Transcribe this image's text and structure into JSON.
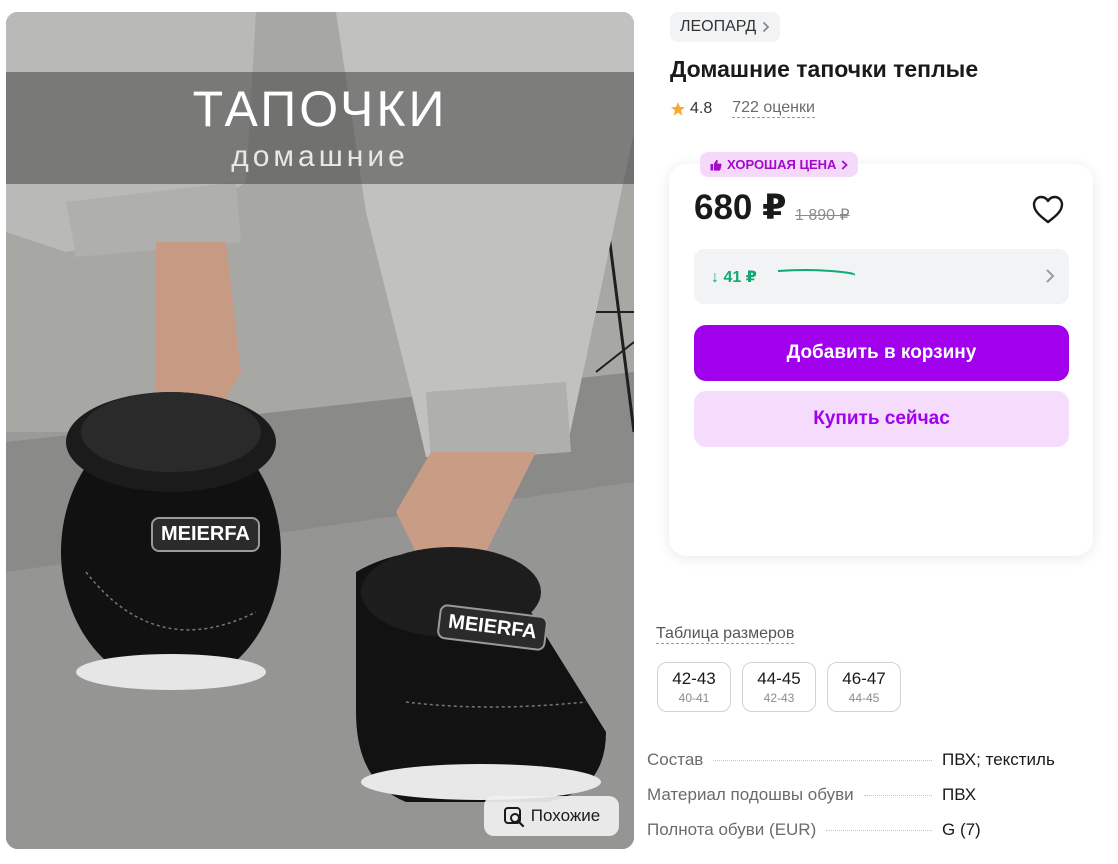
{
  "image": {
    "banner_title": "ТАПОЧКИ",
    "banner_subtitle": "домашние",
    "brand_tag_1": "MEIERFA",
    "brand_tag_2": "MEIERFA",
    "similar_label": "Похожие"
  },
  "brand": {
    "name": "ЛЕОПАРД",
    "icon": "chevron-right-icon"
  },
  "product": {
    "title": "Домашние тапочки теплые"
  },
  "rating": {
    "value": "4.8",
    "reviews": "722 оценки",
    "star_color": "#f7a832"
  },
  "offer": {
    "badge": "ХОРОШАЯ ЦЕНА",
    "price": "680 ₽",
    "old_price": "1 890 ₽",
    "price_drop": "↓ 41 ₽",
    "add_to_cart": "Добавить в корзину",
    "buy_now": "Купить сейчас",
    "accent": "#a100ec",
    "drop_color": "#10a96f"
  },
  "sizes": {
    "link": "Таблица размеров",
    "items": [
      {
        "ru": "42-43",
        "eu": "40-41"
      },
      {
        "ru": "44-45",
        "eu": "42-43"
      },
      {
        "ru": "46-47",
        "eu": "44-45"
      }
    ]
  },
  "specs": [
    {
      "name": "Состав",
      "value": "ПВХ; текстиль"
    },
    {
      "name": "Материал подошвы обуви",
      "value": "ПВХ"
    },
    {
      "name": "Полнота обуви (EUR)",
      "value": "G (7)"
    }
  ]
}
